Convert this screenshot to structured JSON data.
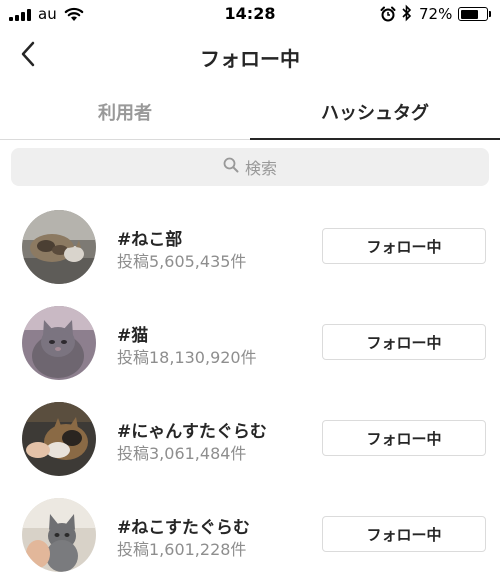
{
  "status_bar": {
    "carrier": "au",
    "time": "14:28",
    "battery_percent": "72%",
    "battery_level": 0.72,
    "icons": [
      "signal-icon",
      "wifi-icon",
      "alarm-icon",
      "bluetooth-icon",
      "battery-icon"
    ]
  },
  "header": {
    "title": "フォロー中",
    "back_icon": "chevron-left-icon"
  },
  "tabs": [
    {
      "label": "利用者",
      "active": false
    },
    {
      "label": "ハッシュタグ",
      "active": true
    }
  ],
  "search": {
    "placeholder": "検索",
    "icon": "search-icon"
  },
  "hashtags": [
    {
      "name": "#ねこ部",
      "posts": "投稿5,605,435件",
      "button_label": "フォロー中"
    },
    {
      "name": "#猫",
      "posts": "投稿18,130,920件",
      "button_label": "フォロー中"
    },
    {
      "name": "#にゃんすたぐらむ",
      "posts": "投稿3,061,484件",
      "button_label": "フォロー中"
    },
    {
      "name": "#ねこすたぐらむ",
      "posts": "投稿1,601,228件",
      "button_label": "フォロー中"
    }
  ],
  "colors": {
    "text_primary": "#262626",
    "text_secondary": "#8e8e8e",
    "tab_inactive": "#999999",
    "border": "#dbdbdb",
    "search_bg": "#efefef"
  }
}
